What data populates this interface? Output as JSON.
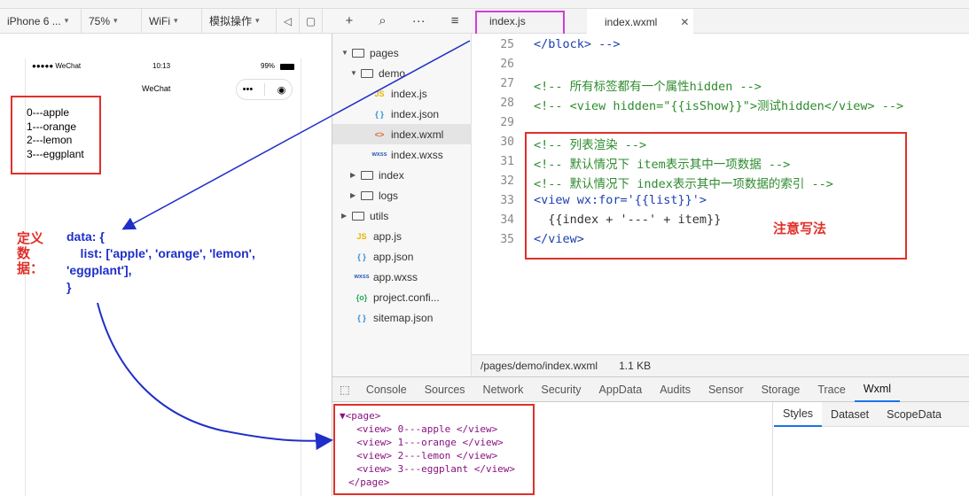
{
  "toolbar": {
    "device": "iPhone 6 ...",
    "zoom": "75%",
    "network": "WiFi",
    "operation": "模拟操作"
  },
  "tabs": [
    {
      "label": "index.js"
    },
    {
      "label": "index.wxml"
    }
  ],
  "phone": {
    "status_left": "●●●●● WeChat",
    "status_time": "10:13",
    "status_right": "99%",
    "nav_title": "WeChat",
    "list_output": [
      "0---apple",
      "1---orange",
      "2---lemon",
      "3---eggplant"
    ]
  },
  "annotations": {
    "data_label": "定义数据：",
    "data_lines": [
      "data: {",
      "    list: ['apple', 'orange', 'lemon',",
      "'eggplant'],",
      "}"
    ],
    "note": "注意写法"
  },
  "filetree": [
    {
      "label": "pages",
      "kind": "folder",
      "open": true
    },
    {
      "label": "demo",
      "kind": "folder",
      "open": true
    },
    {
      "label": "index.js",
      "kind": "js"
    },
    {
      "label": "index.json",
      "kind": "json"
    },
    {
      "label": "index.wxml",
      "kind": "wxml",
      "selected": true
    },
    {
      "label": "index.wxss",
      "kind": "wxss"
    },
    {
      "label": "index",
      "kind": "folder",
      "open": false
    },
    {
      "label": "logs",
      "kind": "folder",
      "open": false
    },
    {
      "label": "utils",
      "kind": "folder",
      "open": false
    },
    {
      "label": "app.js",
      "kind": "js"
    },
    {
      "label": "app.json",
      "kind": "json"
    },
    {
      "label": "app.wxss",
      "kind": "wxss"
    },
    {
      "label": "project.confi...",
      "kind": "config"
    },
    {
      "label": "sitemap.json",
      "kind": "json"
    }
  ],
  "editor": {
    "lines": [
      {
        "n": "25",
        "text": "</block> -->"
      },
      {
        "n": "26",
        "text": ""
      },
      {
        "n": "27",
        "text": "<!-- 所有标签都有一个属性hidden -->"
      },
      {
        "n": "28",
        "text": "<!-- <view hidden=\"{{isShow}}\">测试hidden</view> -->"
      },
      {
        "n": "29",
        "text": ""
      },
      {
        "n": "30",
        "text": "<!-- 列表渲染 -->"
      },
      {
        "n": "31",
        "text": "<!-- 默认情况下 item表示其中一项数据 -->"
      },
      {
        "n": "32",
        "text": "<!-- 默认情况下 index表示其中一项数据的索引 -->"
      },
      {
        "n": "33",
        "text": "<view wx:for='{{list}}'>"
      },
      {
        "n": "34",
        "text": "  {{index + '---' + item}}"
      },
      {
        "n": "35",
        "text": "</view>"
      }
    ]
  },
  "pathbar": {
    "path": "/pages/demo/index.wxml",
    "size": "1.1 KB"
  },
  "devtools": {
    "tabs": [
      "Console",
      "Sources",
      "Network",
      "Security",
      "AppData",
      "Audits",
      "Sensor",
      "Storage",
      "Trace",
      "Wxml"
    ],
    "active": "Wxml",
    "wxml_lines": [
      "▼<page>",
      "  <view> 0---apple </view>",
      "  <view> 1---orange </view>",
      "  <view> 2---lemon </view>",
      "  <view> 3---eggplant </view>",
      "</page>"
    ],
    "side_tabs": [
      "Styles",
      "Dataset",
      "ScopeData"
    ]
  }
}
